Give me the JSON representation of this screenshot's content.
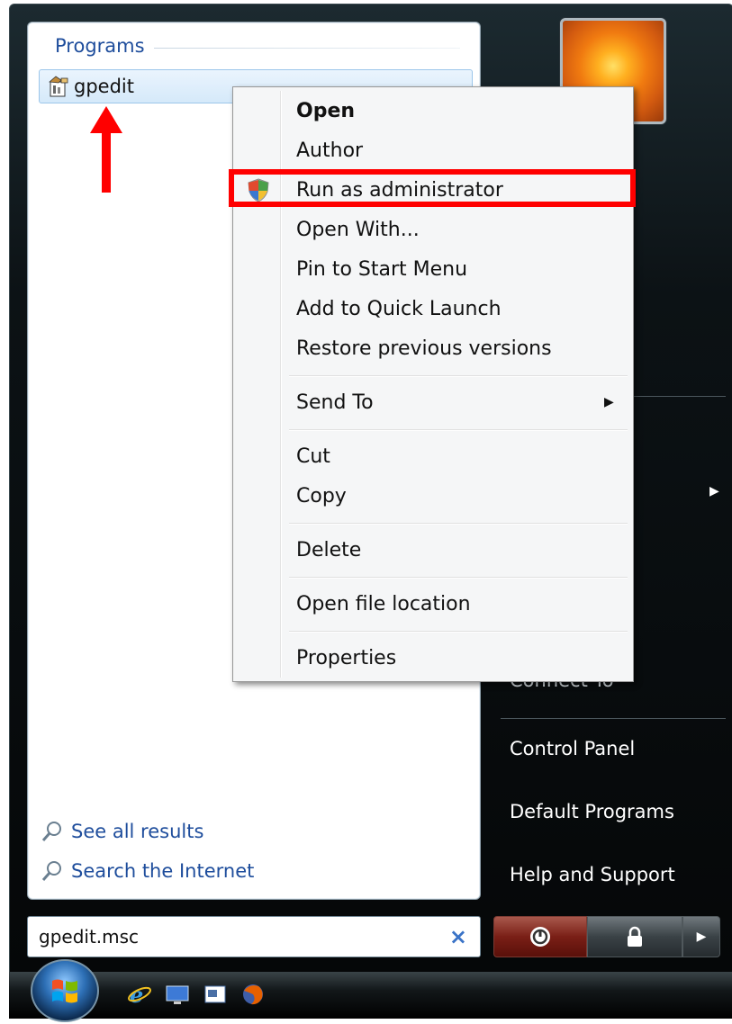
{
  "start_menu": {
    "programs_header": "Programs",
    "program_item": {
      "label": "gpedit",
      "icon": "msc-file-icon"
    },
    "see_all_results": "See all results",
    "search_internet": "Search the Internet",
    "search_box": {
      "value": "gpedit.msc",
      "clear_glyph": "×"
    }
  },
  "right_column": {
    "partial_item": "Connect To",
    "items": [
      "Control Panel",
      "Default Programs",
      "Help and Support"
    ]
  },
  "context_menu": {
    "items": [
      {
        "label": "Open",
        "bold": true
      },
      {
        "label": "Author"
      },
      {
        "label": "Run as administrator",
        "icon": "uac-shield-icon",
        "highlighted": true
      },
      {
        "label": "Open With..."
      },
      {
        "label": "Pin to Start Menu"
      },
      {
        "label": "Add to Quick Launch"
      },
      {
        "label": "Restore previous versions"
      },
      {
        "label": "Send To",
        "submenu": true
      },
      {
        "label": "Cut"
      },
      {
        "label": "Copy"
      },
      {
        "label": "Delete"
      },
      {
        "label": "Open file location"
      },
      {
        "label": "Properties"
      }
    ],
    "submenu_glyph": "▶"
  },
  "power_buttons": {
    "more_glyph": "▶"
  },
  "colors": {
    "annotation": "#ff0000",
    "link": "#1e4d9c"
  }
}
